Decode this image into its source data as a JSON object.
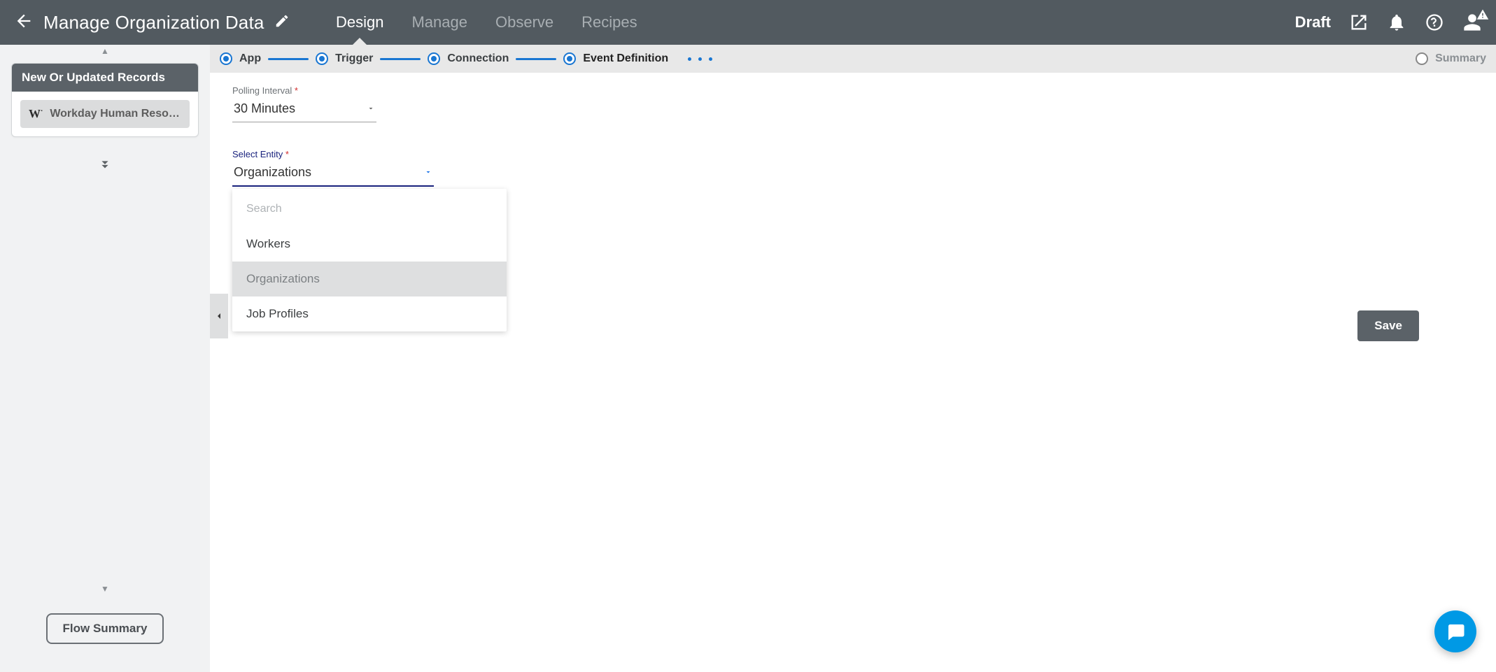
{
  "header": {
    "title": "Manage Organization Data",
    "tabs": [
      "Design",
      "Manage",
      "Observe",
      "Recipes"
    ],
    "active_tab": 0,
    "status": "Draft"
  },
  "sidebar": {
    "card_title": "New Or Updated Records",
    "block": {
      "icon_text": "W",
      "label": "Workday Human Resource"
    },
    "flow_summary_label": "Flow Summary"
  },
  "steps": {
    "items": [
      {
        "label": "App",
        "state": "done"
      },
      {
        "label": "Trigger",
        "state": "done"
      },
      {
        "label": "Connection",
        "state": "done"
      },
      {
        "label": "Event Definition",
        "state": "active"
      },
      {
        "label": "Summary",
        "state": "upcoming"
      }
    ]
  },
  "form": {
    "polling": {
      "label": "Polling Interval",
      "value": "30 Minutes"
    },
    "entity": {
      "label": "Select Entity",
      "value": "Organizations"
    },
    "dropdown": {
      "search_placeholder": "Search",
      "options": [
        "Workers",
        "Organizations",
        "Job Profiles"
      ],
      "selected_index": 1
    },
    "save_label": "Save"
  }
}
